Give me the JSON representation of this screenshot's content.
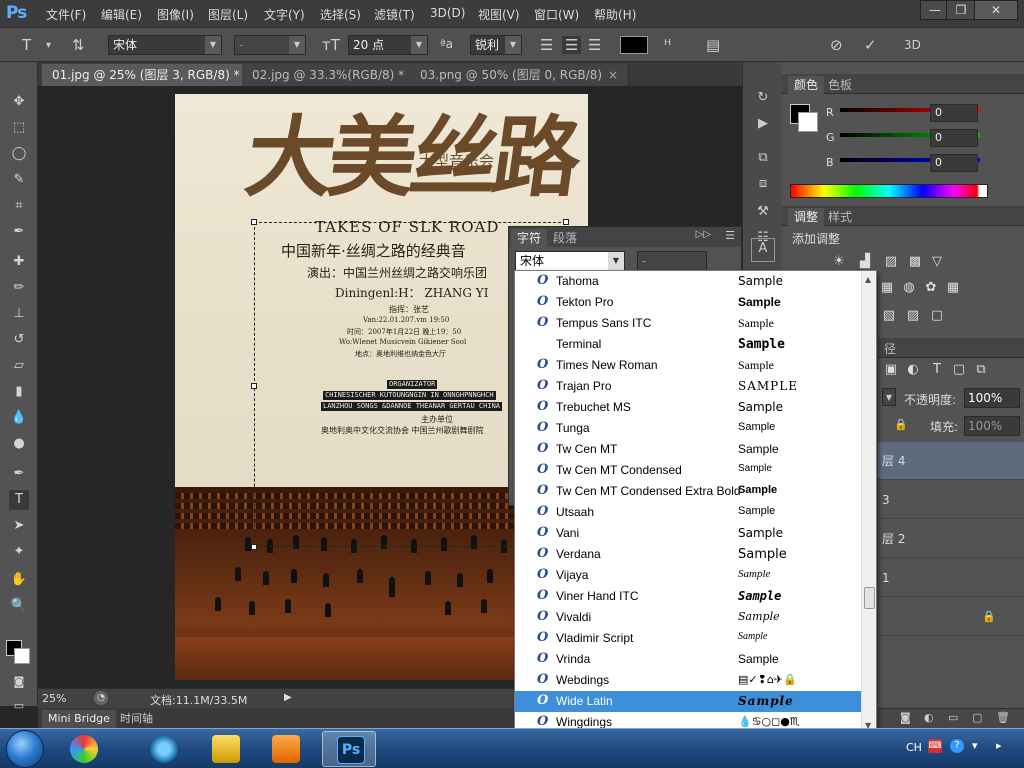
{
  "app": {
    "logo": "Ps"
  },
  "menu": [
    "文件(F)",
    "编辑(E)",
    "图像(I)",
    "图层(L)",
    "文字(Y)",
    "选择(S)",
    "滤镜(T)",
    "3D(D)",
    "视图(V)",
    "窗口(W)",
    "帮助(H)"
  ],
  "window_controls": {
    "minimize": "—",
    "maximize": "❐",
    "close": "✕"
  },
  "options_bar": {
    "font_family": "宋体",
    "font_style": "-",
    "font_size": "20 点",
    "aa_label": "ªa",
    "aa_mode": "锐利",
    "threed": "3D",
    "text_color": "#000000"
  },
  "doc_tabs": [
    {
      "label": "01.jpg @ 25% (图层 3, RGB/8) *",
      "close": "×"
    },
    {
      "label": "02.jpg @ 33.3%(RGB/8) *",
      "close": "×"
    },
    {
      "label": "03.png @ 50% (图层 0, RGB/8)",
      "close": "×"
    }
  ],
  "poster": {
    "calligraphy": "大美丝路",
    "subtitle": "大型音乐会",
    "english_title": "TAKES OF SLK ROAD",
    "chinese_title": "中国新年·丝绸之路的经典音",
    "performer": "演出：中国兰州丝绸之路交响乐团",
    "conductor": "Diningenl:H： ZHANG YI",
    "conductor_cn": "指挥：张艺",
    "date_en": "Van:22.01.207.vm 19:50",
    "date_cn": "时间：2007年1月22日 晚上19：50",
    "venue_en": "Wo:Wlenet Musicvein Gikiener Sool",
    "venue_cn": "地点：奥地利维也纳金色大厅",
    "bar1": "ORGANIZATOR",
    "bar2": "CHINESISCHER KUTOUNGNGIN IN ONNGHPNNGHCH",
    "bar3": "LANZHOU SONGS &DANNOE THEANAR GERTAU CHINA",
    "host_label": "主办单位",
    "hosts": "奥地利奥中文化交流协会   中国兰州歌剧舞剧院"
  },
  "status": {
    "zoom": "25%",
    "doc_size": "文档:11.1M/33.5M"
  },
  "bottom_tabs": [
    "Mini Bridge",
    "时间轴"
  ],
  "color_panel": {
    "tabs": [
      "颜色",
      "色板"
    ],
    "channels": [
      {
        "label": "R",
        "value": "0"
      },
      {
        "label": "G",
        "value": "0"
      },
      {
        "label": "B",
        "value": "0"
      }
    ]
  },
  "adjust_panel": {
    "tabs": [
      "调整",
      "样式"
    ],
    "title": "添加调整"
  },
  "layers_panel": {
    "opacity_label": "不透明度:",
    "opacity": "100%",
    "fill_label": "填充:",
    "fill": "100%",
    "layers": [
      "层 4",
      "3",
      "层 2",
      "1"
    ]
  },
  "char_panel": {
    "tabs": [
      "字符",
      "段落"
    ],
    "font": "宋体",
    "style": "-"
  },
  "font_list": [
    {
      "name": "Tahoma",
      "sample": "Sample"
    },
    {
      "name": "Tekton Pro",
      "sample": "Sample"
    },
    {
      "name": "Tempus Sans ITC",
      "sample": "Sample"
    },
    {
      "name": "Terminal",
      "sample": "Sample"
    },
    {
      "name": "Times New Roman",
      "sample": "Sample"
    },
    {
      "name": "Trajan Pro",
      "sample": "SAMPLE"
    },
    {
      "name": "Trebuchet MS",
      "sample": "Sample"
    },
    {
      "name": "Tunga",
      "sample": "Sample"
    },
    {
      "name": "Tw Cen MT",
      "sample": "Sample"
    },
    {
      "name": "Tw Cen MT Condensed",
      "sample": "Sample"
    },
    {
      "name": "Tw Cen MT Condensed Extra Bold",
      "sample": "Sample"
    },
    {
      "name": "Utsaah",
      "sample": "Sample"
    },
    {
      "name": "Vani",
      "sample": "Sample"
    },
    {
      "name": "Verdana",
      "sample": "Sample"
    },
    {
      "name": "Vijaya",
      "sample": "Sample"
    },
    {
      "name": "Viner Hand ITC",
      "sample": "Sample"
    },
    {
      "name": "Vivaldi",
      "sample": "Sample"
    },
    {
      "name": "Vladimir Script",
      "sample": "Sample"
    },
    {
      "name": "Vrinda",
      "sample": "Sample"
    },
    {
      "name": "Webdings",
      "sample": "▤✓❢⌂✈🔒"
    },
    {
      "name": "Wide Latin",
      "sample": "Sample"
    },
    {
      "name": "Wingdings",
      "sample": "💧♋○◻●♏"
    }
  ],
  "font_selected": "Wide Latin",
  "taskbar": {
    "lang": "CH"
  }
}
